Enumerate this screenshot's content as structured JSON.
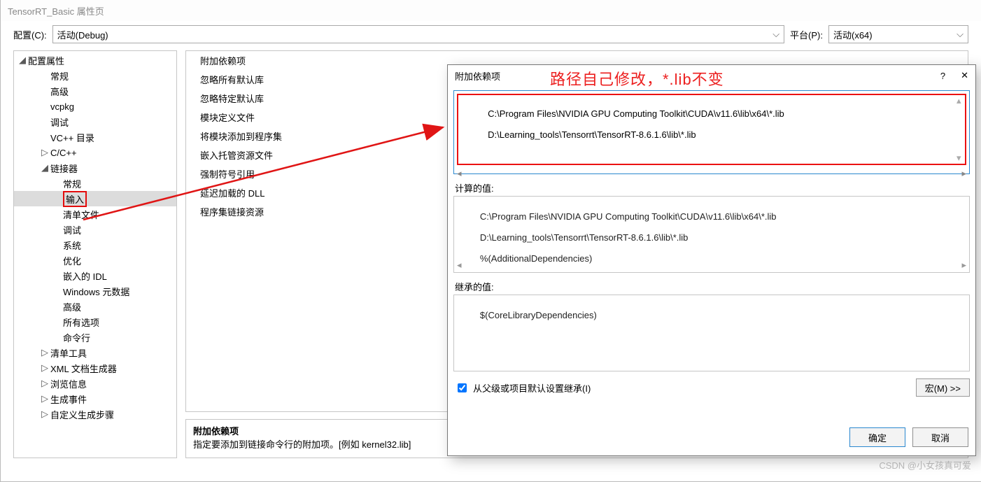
{
  "window": {
    "title": "TensorRT_Basic 属性页"
  },
  "toolbar": {
    "config_label": "配置(C):",
    "config_value": "活动(Debug)",
    "platform_label": "平台(P):",
    "platform_value": "活动(x64)"
  },
  "tree": {
    "root": "配置属性",
    "items": [
      {
        "label": "常规",
        "indent": 2
      },
      {
        "label": "高级",
        "indent": 2
      },
      {
        "label": "vcpkg",
        "indent": 2
      },
      {
        "label": "调试",
        "indent": 2
      },
      {
        "label": "VC++ 目录",
        "indent": 2
      },
      {
        "label": "C/C++",
        "indent": 2,
        "expandable": true
      },
      {
        "label": "链接器",
        "indent": 2,
        "expanded": true
      },
      {
        "label": "常规",
        "indent": 3
      },
      {
        "label": "输入",
        "indent": 3,
        "selected": true,
        "highlight": true
      },
      {
        "label": "清单文件",
        "indent": 3
      },
      {
        "label": "调试",
        "indent": 3
      },
      {
        "label": "系统",
        "indent": 3
      },
      {
        "label": "优化",
        "indent": 3
      },
      {
        "label": "嵌入的 IDL",
        "indent": 3
      },
      {
        "label": "Windows 元数据",
        "indent": 3
      },
      {
        "label": "高级",
        "indent": 3
      },
      {
        "label": "所有选项",
        "indent": 3
      },
      {
        "label": "命令行",
        "indent": 3
      },
      {
        "label": "清单工具",
        "indent": 2,
        "expandable": true
      },
      {
        "label": "XML 文档生成器",
        "indent": 2,
        "expandable": true
      },
      {
        "label": "浏览信息",
        "indent": 2,
        "expandable": true
      },
      {
        "label": "生成事件",
        "indent": 2,
        "expandable": true
      },
      {
        "label": "自定义生成步骤",
        "indent": 2,
        "expandable": true
      }
    ]
  },
  "props": {
    "rows": [
      "附加依赖项",
      "忽略所有默认库",
      "忽略特定默认库",
      "模块定义文件",
      "将模块添加到程序集",
      "嵌入托管资源文件",
      "强制符号引用",
      "延迟加载的 DLL",
      "程序集链接资源"
    ]
  },
  "desc": {
    "title": "附加依赖项",
    "text": "指定要添加到链接命令行的附加项。[例如 kernel32.lib]"
  },
  "dialog": {
    "title": "附加依赖项",
    "help": "?",
    "close": "✕",
    "edit_line1": "C:\\Program Files\\NVIDIA GPU Computing Toolkit\\CUDA\\v11.6\\lib\\x64\\*.lib",
    "edit_line2": "D:\\Learning_tools\\Tensorrt\\TensorRT-8.6.1.6\\lib\\*.lib",
    "computed_label": "计算的值:",
    "computed_line1": "C:\\Program Files\\NVIDIA GPU Computing Toolkit\\CUDA\\v11.6\\lib\\x64\\*.lib",
    "computed_line2": "D:\\Learning_tools\\Tensorrt\\TensorRT-8.6.1.6\\lib\\*.lib",
    "computed_line3": "%(AdditionalDependencies)",
    "inherited_label": "继承的值:",
    "inherited_line1": "$(CoreLibraryDependencies)",
    "inherit_check_label": "从父级或项目默认设置继承(I)",
    "macro_btn": "宏(M) >>",
    "ok": "确定",
    "cancel": "取消"
  },
  "annotation": "路径自己修改，*.lib不变",
  "watermark": "CSDN @小女孩真可爱"
}
